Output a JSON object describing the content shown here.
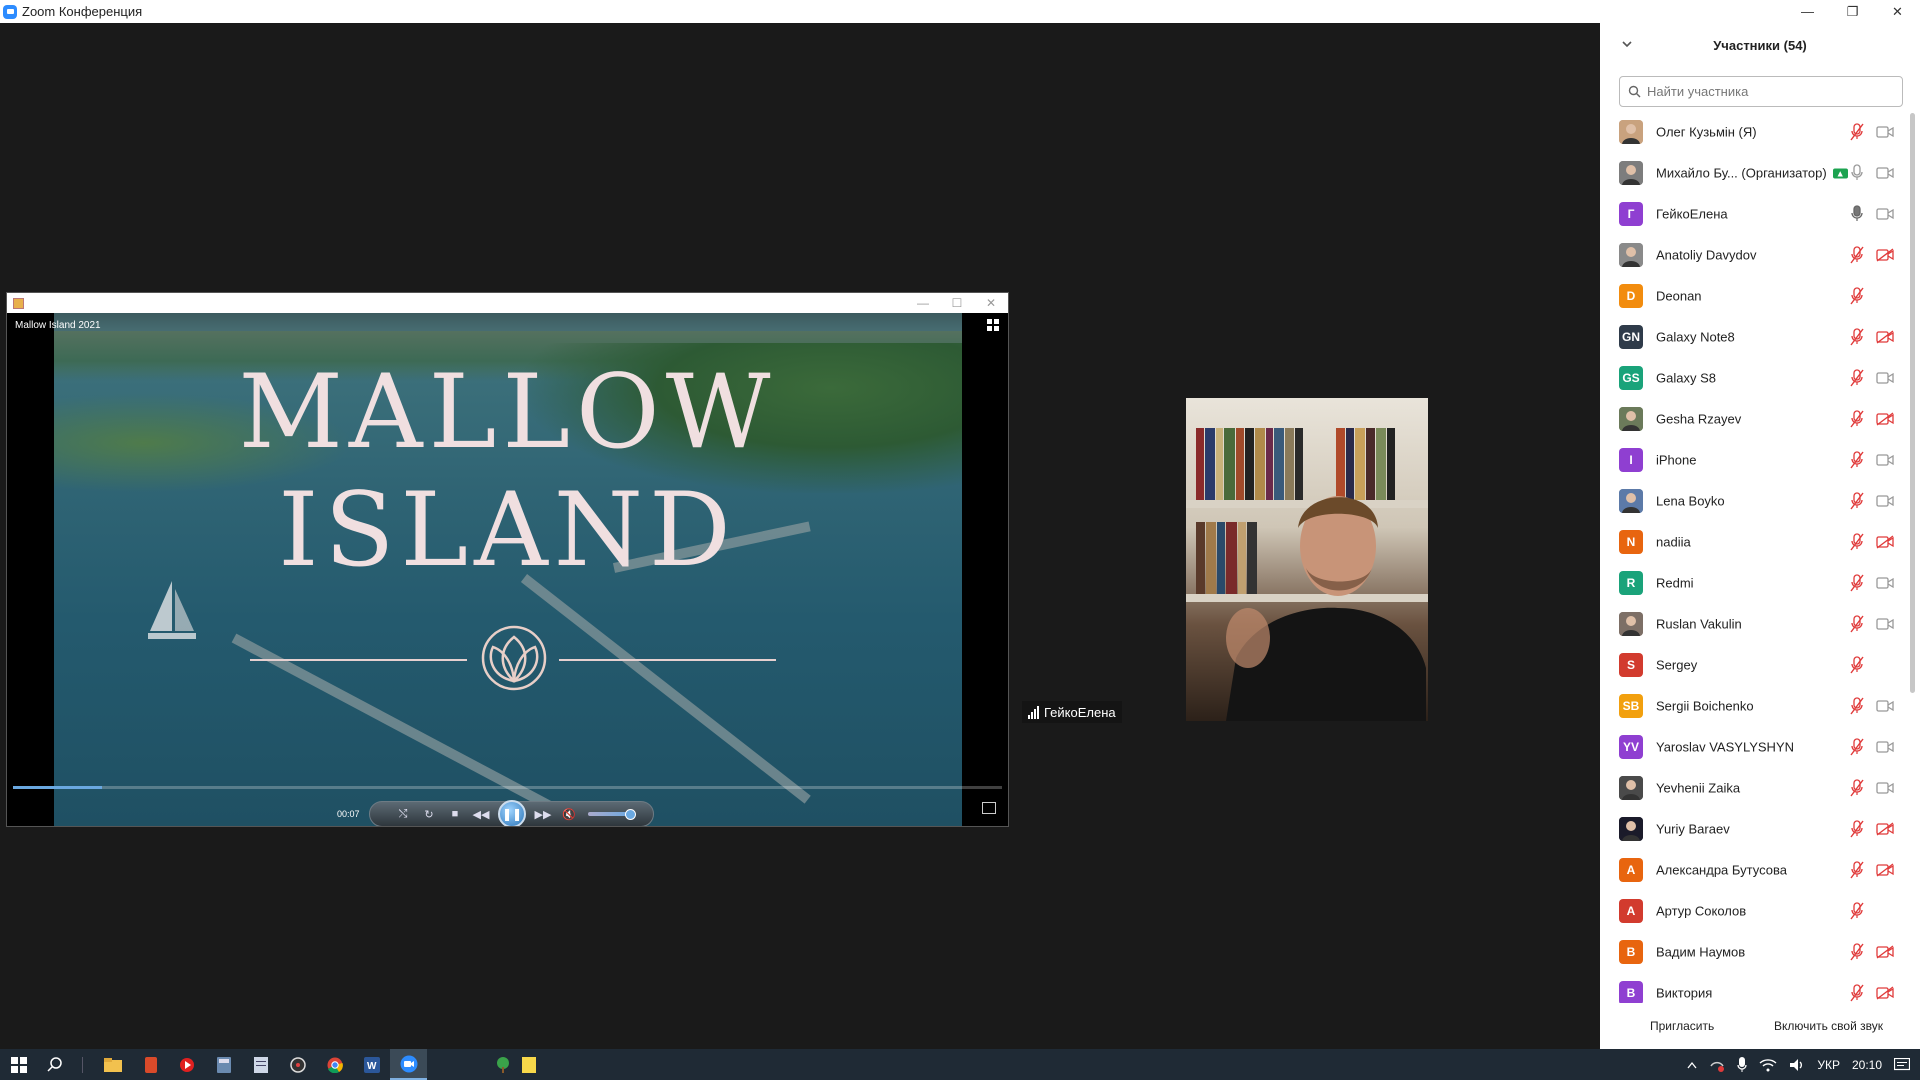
{
  "window": {
    "title": "Zoom Конференция"
  },
  "window_controls": {
    "minimize": "—",
    "restore": "❐",
    "close": "✕"
  },
  "player": {
    "caption": "Mallow Island 2021",
    "time": "00:07",
    "progress": 0.09,
    "volume": 0.65,
    "video_title_line1": "MALLOW",
    "video_title_line2": "ISLAND",
    "controls": {
      "shuffle": "⤭",
      "repeat": "↻",
      "stop": "■",
      "prev": "◀◀",
      "play_pause": "❚❚",
      "next": "▶▶",
      "mute": "🔇"
    },
    "window_controls": {
      "minimize": "—",
      "restore": "☐",
      "close": "✕"
    }
  },
  "speaker": {
    "name": "ГейкоЕлена"
  },
  "panel": {
    "title": "Участники (54)",
    "search_placeholder": "Найти участника",
    "participants": [
      {
        "name": "Олег Кузьмін (Я)",
        "avatar": "photo",
        "color": "#c9a27e",
        "mic": "muted",
        "cam": "on"
      },
      {
        "name": "Михайло Бу... (Организатор)",
        "avatar": "photo",
        "color": "#7d7d7d",
        "badge": "▲",
        "mic": "on",
        "cam": "on"
      },
      {
        "name": "ГейкоЕлена",
        "avatar": "Г",
        "color": "#8f3fd1",
        "mic": "active",
        "cam": "on"
      },
      {
        "name": "Anatoliy Davydov",
        "avatar": "photo",
        "color": "#8a8a8a",
        "mic": "muted",
        "cam": "off"
      },
      {
        "name": "Deonan",
        "avatar": "D",
        "color": "#f28c0e",
        "mic": "muted",
        "cam": "none"
      },
      {
        "name": "Galaxy Note8",
        "avatar": "GN",
        "color": "#2f3b4a",
        "mic": "muted",
        "cam": "off"
      },
      {
        "name": "Galaxy S8",
        "avatar": "GS",
        "color": "#1aa37a",
        "mic": "muted",
        "cam": "on"
      },
      {
        "name": "Gesha Rzayev",
        "avatar": "photo",
        "color": "#6b7a5a",
        "mic": "muted",
        "cam": "off"
      },
      {
        "name": "iPhone",
        "avatar": "I",
        "color": "#8f3fd1",
        "mic": "muted",
        "cam": "on"
      },
      {
        "name": "Lena Boyko",
        "avatar": "photo",
        "color": "#5c7aa8",
        "mic": "muted",
        "cam": "on"
      },
      {
        "name": "nadiia",
        "avatar": "N",
        "color": "#e8650f",
        "mic": "muted",
        "cam": "off"
      },
      {
        "name": "Redmi",
        "avatar": "R",
        "color": "#1aa37a",
        "mic": "muted",
        "cam": "on"
      },
      {
        "name": "Ruslan Vakulin",
        "avatar": "photo",
        "color": "#7d6f66",
        "mic": "muted",
        "cam": "on"
      },
      {
        "name": "Sergey",
        "avatar": "S",
        "color": "#d23b2e",
        "mic": "muted",
        "cam": "none"
      },
      {
        "name": "Sergii Boichenko",
        "avatar": "SB",
        "color": "#f2a00e",
        "mic": "muted",
        "cam": "on"
      },
      {
        "name": "Yaroslav VASYLYSHYN",
        "avatar": "YV",
        "color": "#8f3fd1",
        "mic": "muted",
        "cam": "on"
      },
      {
        "name": "Yevhenii Zaika",
        "avatar": "photo",
        "color": "#4a4a4a",
        "mic": "muted",
        "cam": "on"
      },
      {
        "name": "Yuriy Baraev",
        "avatar": "photo",
        "color": "#1b1b2a",
        "mic": "muted",
        "cam": "off"
      },
      {
        "name": "Александра Бутусова",
        "avatar": "A",
        "color": "#e8650f",
        "mic": "muted",
        "cam": "off"
      },
      {
        "name": "Артур Соколов",
        "avatar": "A",
        "color": "#d23b2e",
        "mic": "muted",
        "cam": "none"
      },
      {
        "name": "Вадим Наумов",
        "avatar": "B",
        "color": "#e8650f",
        "mic": "muted",
        "cam": "off"
      },
      {
        "name": "Виктория",
        "avatar": "B",
        "color": "#8f3fd1",
        "mic": "muted",
        "cam": "off"
      }
    ],
    "footer": {
      "invite": "Пригласить",
      "unmute": "Включить свой звук"
    }
  },
  "taskbar": {
    "icons": [
      "windows-start-icon",
      "search-icon",
      "file-explorer-icon",
      "app-icon",
      "media-icon",
      "calculator-icon",
      "notepad-icon",
      "media-player-icon",
      "chrome-icon",
      "word-icon",
      "zoom-icon",
      "tree-icon",
      "sticky-notes-icon"
    ],
    "lang": "УКР",
    "time": "20:10"
  },
  "colors": {
    "accent": "#2d8cff",
    "muted_red": "#e03a3a",
    "background": "#1a1a1a"
  }
}
